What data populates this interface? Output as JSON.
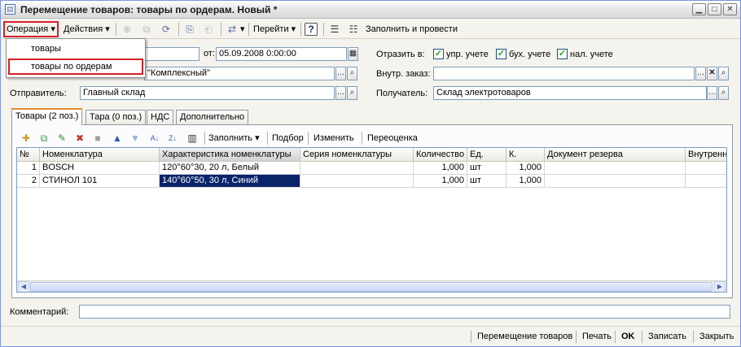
{
  "window": {
    "title": "Перемещение товаров: товары по ордерам. Новый *"
  },
  "toolbar": {
    "operation_label": "Операция",
    "actions_label": "Действия",
    "goto_label": "Перейти",
    "help_label": "?",
    "fill_and_post_label": "Заполнить и провести"
  },
  "operation_menu": {
    "items": [
      "товары",
      "товары по ордерам"
    ],
    "selected_index": 1
  },
  "form": {
    "date_label": "от:",
    "date_value": "05.09.2008  0:00:00",
    "reflect_label": "Отразить в:",
    "checks": [
      {
        "label": "упр. учете",
        "checked": true
      },
      {
        "label": "бух. учете",
        "checked": true
      },
      {
        "label": "нал. учете",
        "checked": true
      }
    ],
    "org_value_fragment": "\"Комплексный\"",
    "internal_order_label": "Внутр. заказ:",
    "internal_order_value": "",
    "sender_label": "Отправитель:",
    "sender_value": "Главный склад",
    "receiver_label": "Получатель:",
    "receiver_value": "Склад электротоваров",
    "comment_label": "Комментарий:",
    "comment_value": ""
  },
  "tabs": [
    {
      "label": "Товары (2 поз.)",
      "active": true
    },
    {
      "label": "Тара (0 поз.)",
      "active": false
    },
    {
      "label": "НДС",
      "active": false
    },
    {
      "label": "Дополнительно",
      "active": false
    }
  ],
  "table_toolbar": {
    "fill_label": "Заполнить",
    "select_label": "Подбор",
    "edit_label": "Изменить",
    "revalue_label": "Переоценка"
  },
  "table": {
    "columns": [
      "№",
      "Номенклатура",
      "Характеристика номенклатуры",
      "Серия номенклатуры",
      "Количество",
      "Ед.",
      "К.",
      "Документ резерва",
      "Внутренн"
    ],
    "rows": [
      [
        "1",
        "BOSCH",
        "120°60°30, 20 л, Белый",
        "",
        "1,000",
        "шт",
        "1,000",
        "",
        ""
      ],
      [
        "2",
        "СТИНОЛ 101",
        "140°60°50, 30 л, Синий",
        "",
        "1,000",
        "шт",
        "1,000",
        "",
        ""
      ]
    ],
    "selected_row": 1,
    "selected_col": 2
  },
  "bottom": {
    "doc_label": "Перемещение товаров",
    "print_label": "Печать",
    "ok_label": "OK",
    "save_label": "Записать",
    "close_label": "Закрыть"
  },
  "colors": {
    "highlight_border": "#d61f2a",
    "selection": "#0a246a",
    "tab_accent": "#e68b2c"
  }
}
